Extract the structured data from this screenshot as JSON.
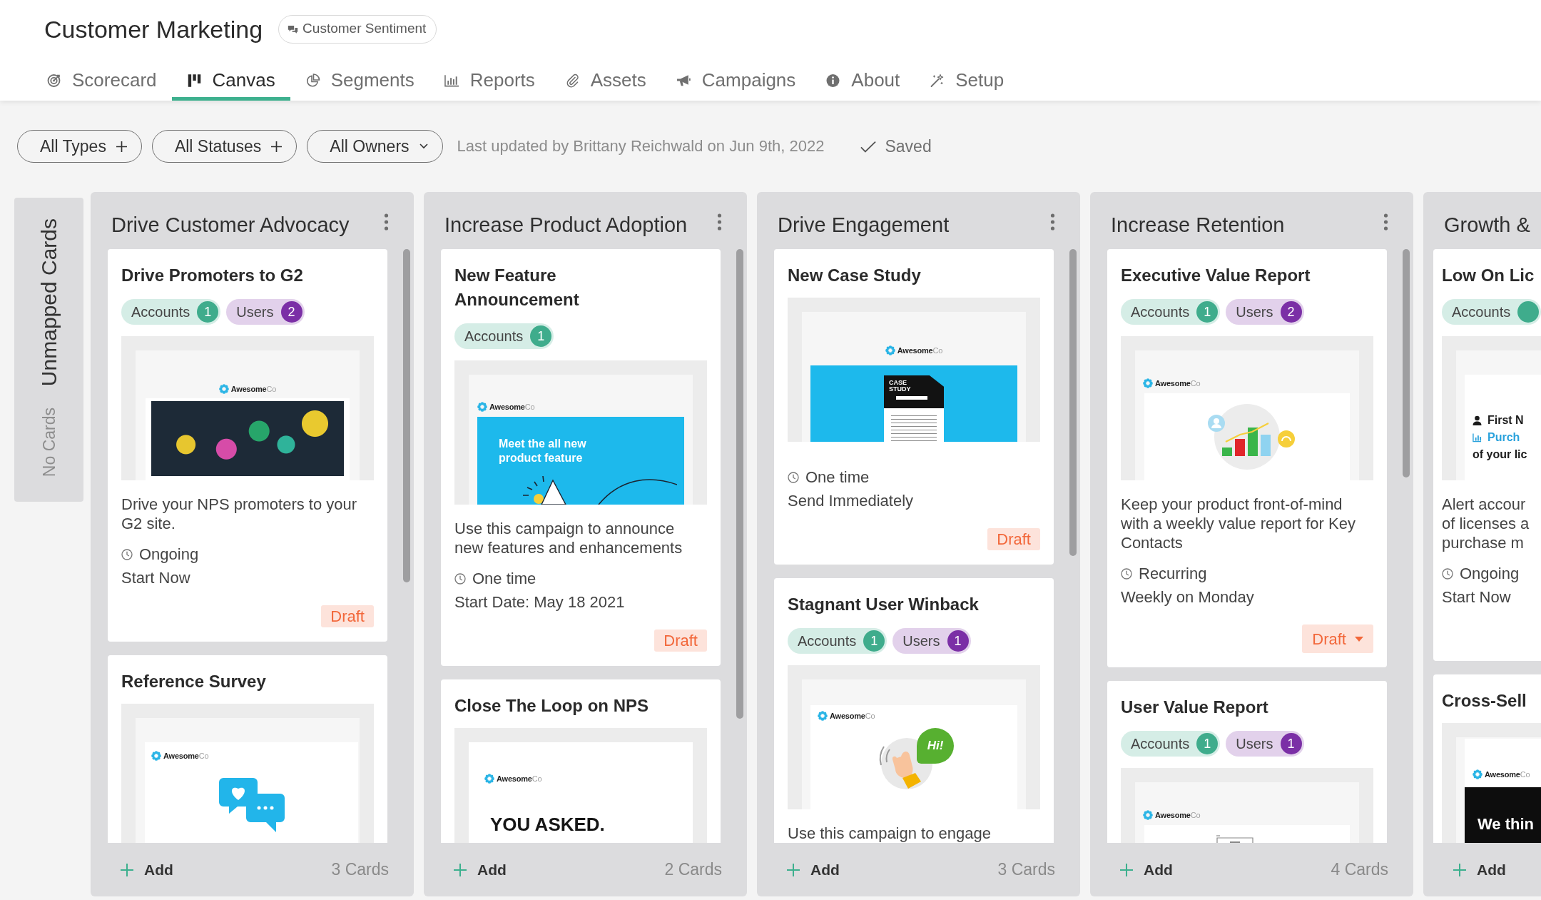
{
  "header": {
    "title": "Customer Marketing",
    "chip": "Customer Sentiment"
  },
  "tabs": [
    {
      "label": "Scorecard",
      "selected": false
    },
    {
      "label": "Canvas",
      "selected": true
    },
    {
      "label": "Segments",
      "selected": false
    },
    {
      "label": "Reports",
      "selected": false
    },
    {
      "label": "Assets",
      "selected": false
    },
    {
      "label": "Campaigns",
      "selected": false
    },
    {
      "label": "About",
      "selected": false
    },
    {
      "label": "Setup",
      "selected": false
    }
  ],
  "filters": [
    {
      "label": "All Types",
      "kind": "add"
    },
    {
      "label": "All Statuses",
      "kind": "add"
    },
    {
      "label": "All Owners",
      "kind": "select"
    }
  ],
  "last_updated": "Last updated by Brittany Reichwald on Jun 9th, 2022",
  "save_state": "Saved",
  "unmapped": {
    "title": "Unmapped Cards",
    "empty": "No Cards"
  },
  "columns": [
    {
      "title": "Drive Customer Advocacy",
      "cards": [
        {
          "title": "Drive Promoters to G2",
          "tags": [
            {
              "label": "Accounts",
              "count": "1",
              "color": "#3fac8c"
            },
            {
              "label": "Users",
              "count": "2",
              "color": "#7b2fa6"
            }
          ],
          "preview": {
            "kind": "photo",
            "logo": "**Awesome**Co"
          },
          "description": "Drive your NPS promoters to your G2 site.",
          "schedule": "Ongoing",
          "timing": "Start Now",
          "status": {
            "label": "Draft",
            "dropdown": false
          }
        },
        {
          "title": "Reference Survey",
          "preview": {
            "kind": "chat",
            "logo": "**Awesome**Co"
          }
        }
      ],
      "add": "Add",
      "count": "3 Cards"
    },
    {
      "title": "Increase Product Adoption",
      "cards": [
        {
          "title": "New Feature Announcement",
          "tags": [
            {
              "label": "Accounts",
              "count": "1",
              "color": "#3fac8c"
            }
          ],
          "preview": {
            "kind": "banner",
            "logo": "**Awesome**Co",
            "headline": "Meet the all new product feature"
          },
          "description": "Use this campaign to announce new features and enhancements",
          "schedule": "One time",
          "timing": "Start Date: May 18 2021",
          "status": {
            "label": "Draft",
            "dropdown": false
          }
        },
        {
          "title": "Close The Loop on NPS",
          "preview": {
            "kind": "headline",
            "logo": "**Awesome**Co",
            "headline": "YOU ASKED."
          }
        }
      ],
      "add": "Add",
      "count": "2 Cards"
    },
    {
      "title": "Drive Engagement",
      "cards": [
        {
          "title": "New Case Study",
          "preview": {
            "kind": "document",
            "logo": "**Awesome**Co",
            "headline": "CASE STUDY"
          },
          "schedule": "One time",
          "timing": "Send Immediately",
          "status": {
            "label": "Draft",
            "dropdown": false
          }
        },
        {
          "title": "Stagnant User Winback",
          "tags": [
            {
              "label": "Accounts",
              "count": "1",
              "color": "#3fac8c"
            },
            {
              "label": "Users",
              "count": "1",
              "color": "#7b2fa6"
            }
          ],
          "preview": {
            "kind": "greeting",
            "logo": "**Awesome**Co",
            "bubble": "Hi!"
          },
          "description": "Use this campaign to engage"
        }
      ],
      "add": "Add",
      "count": "3 Cards"
    },
    {
      "title": "Increase Retention",
      "cards": [
        {
          "title": "Executive Value Report",
          "tags": [
            {
              "label": "Accounts",
              "count": "1",
              "color": "#3fac8c"
            },
            {
              "label": "Users",
              "count": "2",
              "color": "#7b2fa6"
            }
          ],
          "preview": {
            "kind": "chart",
            "logo": "**Awesome**Co"
          },
          "description": "Keep your product front-of-mind with a weekly value report for Key Contacts",
          "schedule": "Recurring",
          "timing": "Weekly on Monday",
          "status": {
            "label": "Draft",
            "dropdown": true
          }
        },
        {
          "title": "User Value Report",
          "tags": [
            {
              "label": "Accounts",
              "count": "1",
              "color": "#3fac8c"
            },
            {
              "label": "Users",
              "count": "1",
              "color": "#7b2fa6"
            }
          ],
          "preview": {
            "kind": "form",
            "logo": "**Awesome**Co"
          }
        }
      ],
      "add": "Add",
      "count": "4 Cards"
    },
    {
      "title": "Growth &",
      "cards": [
        {
          "title": "Low On Lic",
          "tags": [
            {
              "label": "Accounts",
              "color": "#3fac8c"
            }
          ],
          "preview": {
            "kind": "profile",
            "lines": [
              {
                "text": "First N",
                "kind": "person"
              },
              {
                "text": "Purch",
                "kind": "link"
              },
              {
                "text": "of your lic",
                "kind": "bold"
              }
            ]
          },
          "description": "Alert accour\nof licenses a\npurchase m",
          "schedule": "Ongoing",
          "timing": "Start Now"
        },
        {
          "title": "Cross-Sell",
          "preview": {
            "kind": "dark",
            "logo": "**Awesome**Co",
            "headline": "We thin"
          }
        }
      ],
      "add": "Add"
    }
  ]
}
